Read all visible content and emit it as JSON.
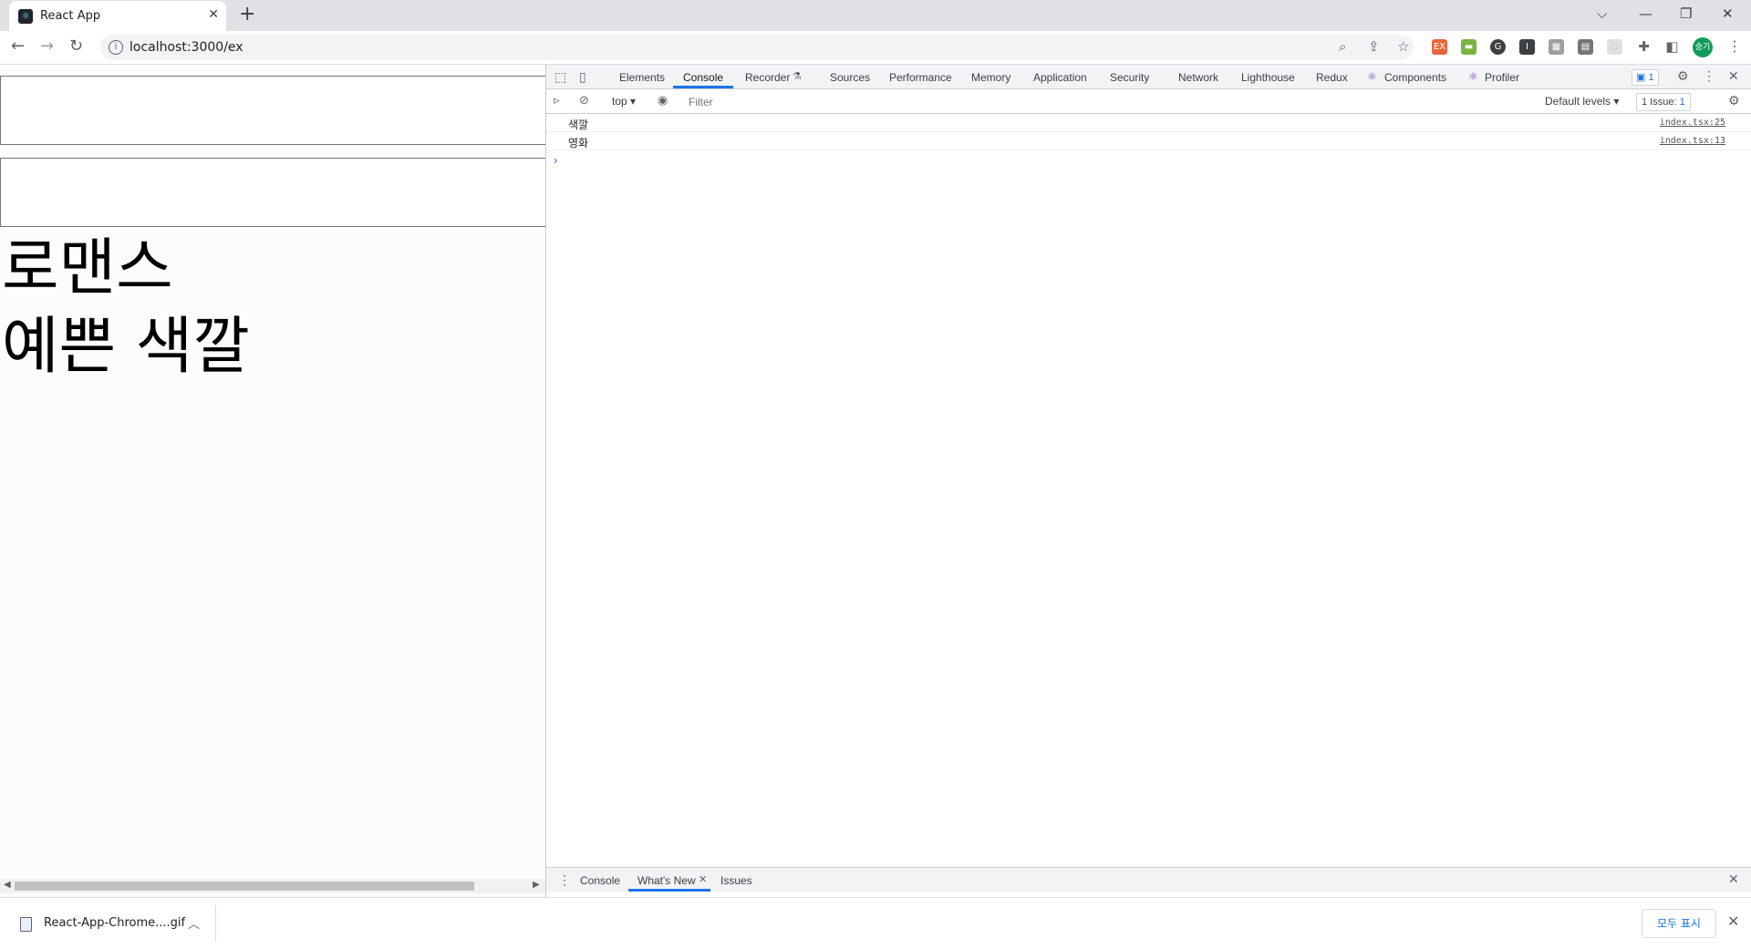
{
  "browser": {
    "tab_title": "React App",
    "tab_close": "✕",
    "new_tab": "+",
    "url": "localhost:3000/ex",
    "window_controls": {
      "dropdown": "⌵",
      "minimize": "—",
      "restore": "❐",
      "close": "✕"
    },
    "nav": {
      "back": "←",
      "forward": "→",
      "reload": "↻"
    },
    "extensions": [
      {
        "name": "ext-icon-1",
        "color": "#e8663d",
        "label": "EX"
      },
      {
        "name": "ext-icon-2",
        "color": "#7cb342",
        "label": "▬"
      },
      {
        "name": "ext-icon-3",
        "color": "#3c4043",
        "label": "G"
      },
      {
        "name": "ext-icon-4",
        "color": "#3c4043",
        "label": "I"
      },
      {
        "name": "ext-icon-5",
        "color": "#9e9e9e",
        "label": "▦"
      },
      {
        "name": "ext-icon-6",
        "color": "#757575",
        "label": "▤"
      },
      {
        "name": "ext-icon-7",
        "color": "#e0e0e0",
        "label": "◌"
      }
    ],
    "avatar": "승기"
  },
  "page": {
    "genre_text": "로맨스",
    "color_text": "예쁜 색깔"
  },
  "devtools": {
    "tabs": [
      "Elements",
      "Console",
      "Recorder",
      "Sources",
      "Performance",
      "Memory",
      "Application",
      "Security",
      "Network",
      "Lighthouse",
      "Redux",
      "Components",
      "Profiler"
    ],
    "active_tab": "Console",
    "message_badge": "1",
    "console_bar": {
      "context": "top",
      "filter_placeholder": "Filter",
      "levels": "Default levels",
      "issues_label": "1 Issue:",
      "issues_count": "1"
    },
    "logs": [
      {
        "message": "색깔",
        "source": "index.tsx:25"
      },
      {
        "message": "영화",
        "source": "index.tsx:13"
      }
    ],
    "prompt": "›",
    "drawer": {
      "tabs": [
        "Console",
        "What's New",
        "Issues"
      ],
      "active": "What's New"
    }
  },
  "download_shelf": {
    "file_name": "React-App-Chrome....gif",
    "show_all": "모두 표시"
  },
  "colors": {
    "accent": "#1a73e8",
    "chrome_bg": "#dfe1e5"
  }
}
